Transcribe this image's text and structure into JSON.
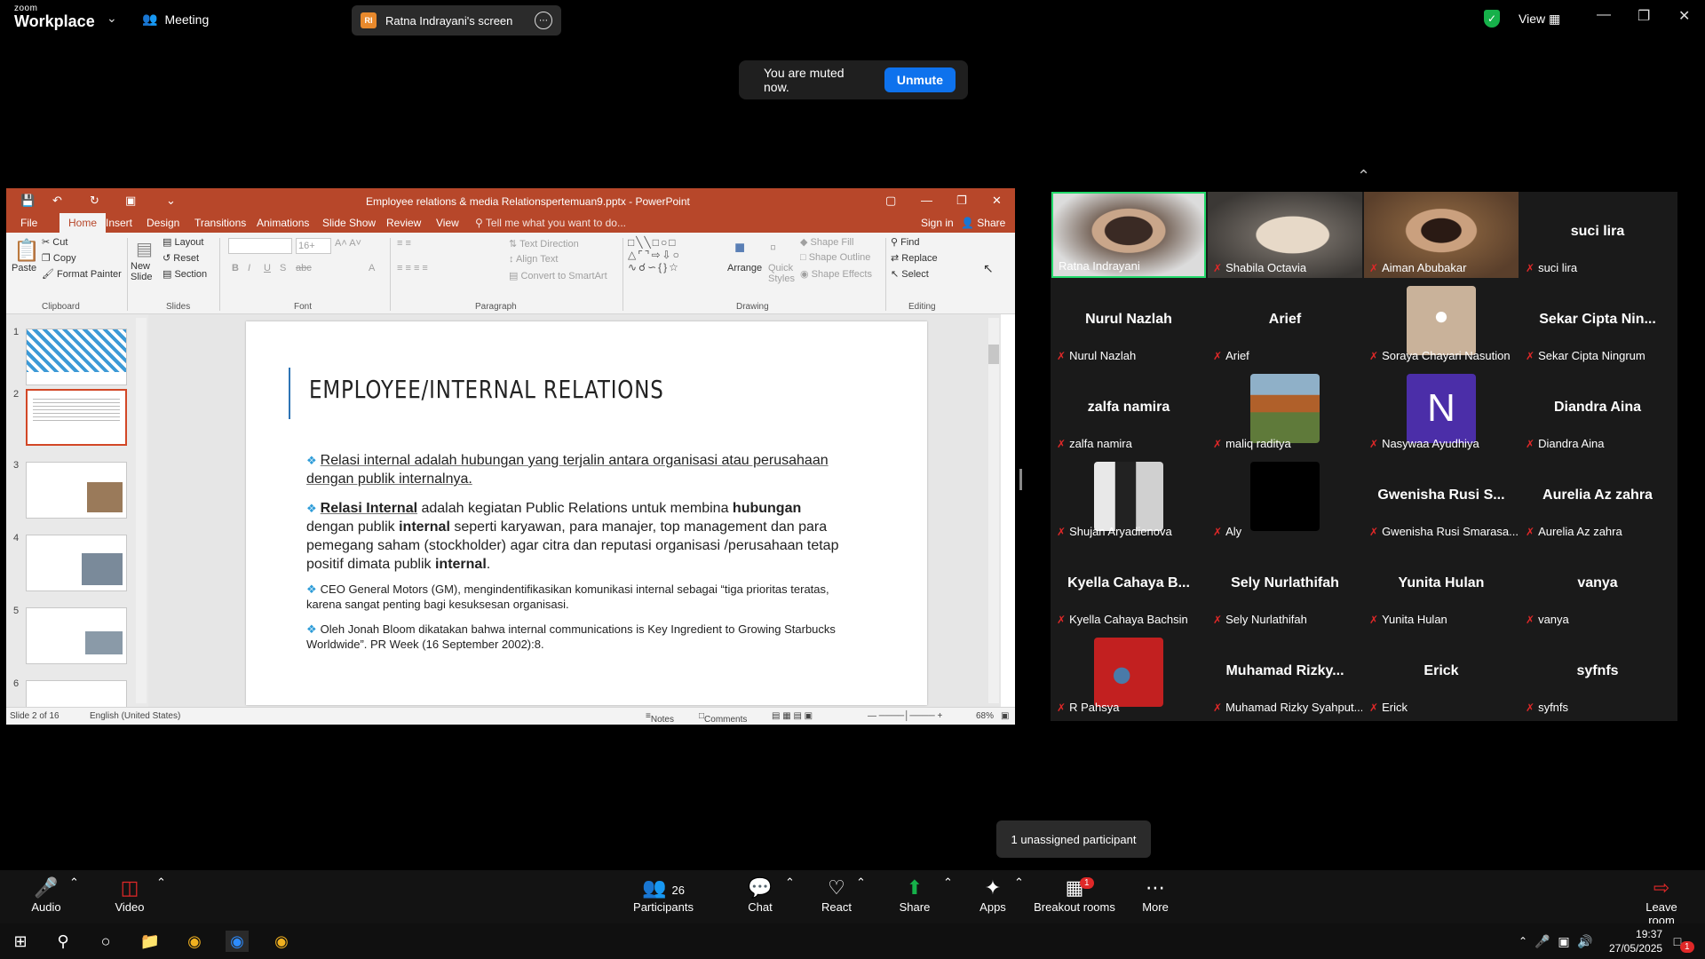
{
  "zoom": {
    "logo_small": "zoom",
    "logo_big": "Workplace",
    "meeting_label": "Meeting",
    "share_initials": "RI",
    "share_title": "Ratna Indrayani's screen",
    "view_label": "View",
    "muted_text": "You are muted now.",
    "unmute_label": "Unmute",
    "unassigned": "1 unassigned participant",
    "participants_count": "26",
    "breakout_badge": "1",
    "controls": {
      "audio": "Audio",
      "video": "Video",
      "participants": "Participants",
      "chat": "Chat",
      "react": "React",
      "share": "Share",
      "apps": "Apps",
      "breakout": "Breakout rooms",
      "more": "More",
      "leave": "Leave room"
    },
    "colors": {
      "accent": "#0e72ed",
      "speaking": "#23d96b",
      "muted": "#e02828"
    }
  },
  "ppt": {
    "window_title": "Employee relations & media Relationspertemuan9.pptx - PowerPoint",
    "tabs": [
      "File",
      "Home",
      "Insert",
      "Design",
      "Transitions",
      "Animations",
      "Slide Show",
      "Review",
      "View"
    ],
    "tell_me": "Tell me what you want to do...",
    "sign_in": "Sign in",
    "share": "Share",
    "ribbon": {
      "paste": "Paste",
      "cut": "Cut",
      "copy": "Copy",
      "format_painter": "Format Painter",
      "clipboard": "Clipboard",
      "new_slide": "New Slide",
      "layout": "Layout",
      "reset": "Reset",
      "section": "Section",
      "slides": "Slides",
      "font_size": "16+",
      "font": "Font",
      "text_direction": "Text Direction",
      "align_text": "Align Text",
      "convert_smartart": "Convert to SmartArt",
      "paragraph": "Paragraph",
      "arrange": "Arrange",
      "quick_styles": "Quick Styles",
      "shape_fill": "Shape Fill",
      "shape_outline": "Shape Outline",
      "shape_effects": "Shape Effects",
      "drawing": "Drawing",
      "find": "Find",
      "replace": "Replace",
      "select": "Select",
      "editing": "Editing"
    },
    "thumb_numbers": [
      "1",
      "2",
      "3",
      "4",
      "5",
      "6"
    ],
    "slide": {
      "title": "EMPLOYEE/INTERNAL RELATIONS",
      "b1": "Relasi internal adalah hubungan yang terjalin antara organisasi atau perusahaan dengan publik internalnya.",
      "b2_bold1": "Relasi Internal",
      "b2_text1": " adalah kegiatan Public Relations untuk membina ",
      "b2_bold2": "hubungan",
      "b2_text2": " dengan publik ",
      "b2_bold3": "internal",
      "b2_text3": " seperti karyawan, para manajer, top management dan para pemegang saham (stockholder) agar citra dan reputasi organisasi /perusahaan tetap positif dimata publik ",
      "b2_bold4": "internal",
      "b2_end": ".",
      "b3": "CEO General Motors (GM), mengindentifikasikan komunikasi internal sebagai “tiga prioritas teratas, karena sangat penting bagi kesuksesan organisasi.",
      "b4": "Oleh Jonah Bloom dikatakan bahwa internal communications is Key Ingredient to Growing Starbucks Worldwide”. PR Week (16 September 2002):8."
    },
    "status": {
      "slide_of": "Slide 2 of 16",
      "language": "English (United States)",
      "notes": "Notes",
      "comments": "Comments",
      "zoom": "68%"
    },
    "accent": "#b7472a"
  },
  "participants": [
    {
      "name": "Ratna Indrayani",
      "video": true,
      "speaking": true,
      "muted": false
    },
    {
      "name": "Shabila Octavia",
      "video": true,
      "muted": true
    },
    {
      "name": "Aiman Abubakar",
      "video": true,
      "muted": true
    },
    {
      "name": "suci lira",
      "display": "suci lira",
      "muted": true
    },
    {
      "name": "Nurul Nazlah",
      "display": "Nurul Nazlah",
      "muted": true
    },
    {
      "name": "Arief",
      "display": "Arief",
      "muted": true
    },
    {
      "name": "Soraya Chayari Nasution",
      "avatar": true,
      "muted": true
    },
    {
      "name": "Sekar Cipta Ningrum",
      "display": "Sekar Cipta Nin...",
      "muted": true
    },
    {
      "name": "zalfa namira",
      "display": "zalfa namira",
      "muted": true
    },
    {
      "name": "maliq raditya",
      "avatar": true,
      "muted": true
    },
    {
      "name": "Nasywaa Ayudhiya",
      "letter": "N",
      "muted": true
    },
    {
      "name": "Diandra Aina",
      "display": "Diandra Aina",
      "muted": true
    },
    {
      "name": "Shujan Aryadienova",
      "avatar": true,
      "muted": true
    },
    {
      "name": "Aly",
      "avatar": true,
      "muted": true
    },
    {
      "name": "Gwenisha Rusi Smarasa...",
      "display": "Gwenisha Rusi S...",
      "muted": true
    },
    {
      "name": "Aurelia Az zahra",
      "display": "Aurelia Az zahra",
      "muted": true
    },
    {
      "name": "Kyella Cahaya Bachsin",
      "display": "Kyella Cahaya B...",
      "muted": true
    },
    {
      "name": "Sely Nurlathifah",
      "display": "Sely Nurlathifah",
      "muted": true
    },
    {
      "name": "Yunita Hulan",
      "display": "Yunita Hulan",
      "muted": true
    },
    {
      "name": "vanya",
      "display": "vanya",
      "muted": true
    },
    {
      "name": "R Pahsya",
      "avatar": true,
      "muted": true
    },
    {
      "name": "Muhamad Rizky Syahput...",
      "display": "Muhamad Rizky...",
      "muted": true
    },
    {
      "name": "Erick",
      "display": "Erick",
      "muted": true
    },
    {
      "name": "syfnfs",
      "display": "syfnfs",
      "muted": true
    }
  ],
  "taskbar": {
    "time": "19:37",
    "date": "27/05/2025",
    "notif_count": "1"
  }
}
